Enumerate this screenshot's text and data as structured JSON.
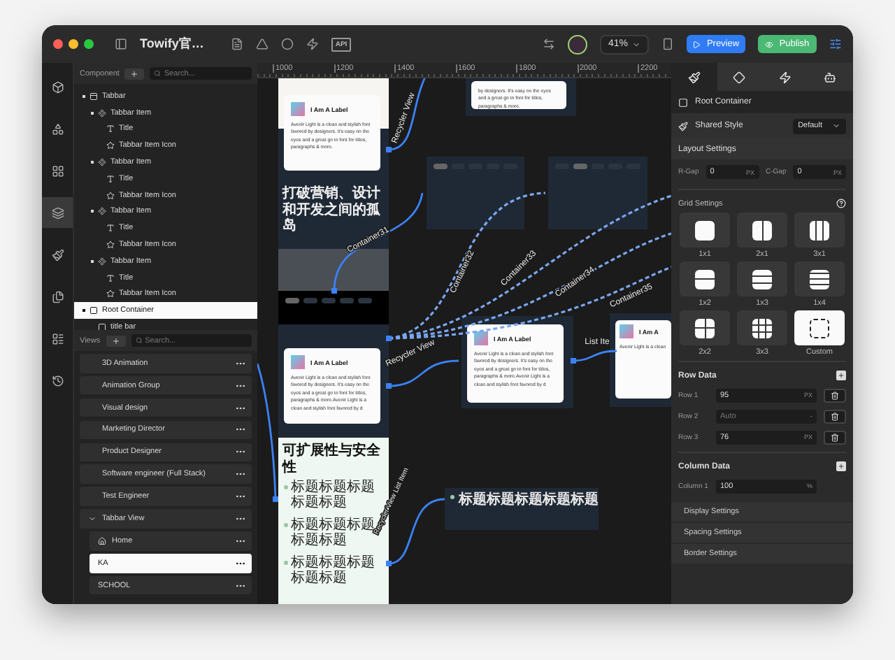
{
  "window": {
    "title": "Towify官…",
    "toolbar_badge": "API",
    "zoom": "41%",
    "buttons": [
      {
        "label": "Preview",
        "kind": "preview"
      },
      {
        "label": "Publish",
        "kind": "publish"
      }
    ]
  },
  "rail": [
    {
      "selected": false
    },
    {
      "selected": false
    },
    {
      "selected": false
    },
    {
      "selected": true
    },
    {
      "selected": false
    },
    {
      "selected": false
    },
    {
      "selected": false
    },
    {
      "selected": false
    }
  ],
  "component_panel": {
    "label": "Component",
    "search_placeholder": "Search...",
    "tree": [
      {
        "label": "Tabbar",
        "kind": "tabbar",
        "selected": false,
        "children": [
          {
            "label": "Tabbar Item",
            "kind": "item",
            "selected": false,
            "children": [
              {
                "label": "Title",
                "kind": "title",
                "selected": false
              },
              {
                "label": "Tabbar Item Icon",
                "kind": "icon",
                "selected": false
              }
            ]
          },
          {
            "label": "Tabbar Item",
            "kind": "item",
            "selected": false,
            "children": [
              {
                "label": "Title",
                "kind": "title",
                "selected": false
              },
              {
                "label": "Tabbar Item Icon",
                "kind": "icon",
                "selected": false
              }
            ]
          },
          {
            "label": "Tabbar Item",
            "kind": "item",
            "selected": false,
            "children": [
              {
                "label": "Title",
                "kind": "title",
                "selected": false
              },
              {
                "label": "Tabbar Item Icon",
                "kind": "icon",
                "selected": false
              }
            ]
          },
          {
            "label": "Tabbar Item",
            "kind": "item",
            "selected": false,
            "children": [
              {
                "label": "Title",
                "kind": "title",
                "selected": false
              },
              {
                "label": "Tabbar Item Icon",
                "kind": "icon",
                "selected": false
              }
            ]
          }
        ]
      },
      {
        "label": "Root Container",
        "kind": "container",
        "selected": true,
        "children": [
          {
            "label": "title bar",
            "kind": "container",
            "selected": false
          }
        ]
      }
    ]
  },
  "views_panel": {
    "label": "Views",
    "search_placeholder": "Search...",
    "items": [
      {
        "label": "3D Animation",
        "kind": "view",
        "selected": false
      },
      {
        "label": "Animation Group",
        "kind": "view",
        "selected": false
      },
      {
        "label": "Visual design",
        "kind": "view",
        "selected": false
      },
      {
        "label": "Marketing Director",
        "kind": "view",
        "selected": false
      },
      {
        "label": "Product Designer",
        "kind": "view",
        "selected": false
      },
      {
        "label": "Software engineer (Full Stack)",
        "kind": "view",
        "selected": false
      },
      {
        "label": "Test Engineer",
        "kind": "view",
        "selected": false
      },
      {
        "label": "Tabbar View",
        "kind": "group",
        "selected": false,
        "expanded": true,
        "children": [
          {
            "label": "Home",
            "kind": "home",
            "selected": false
          },
          {
            "label": "KA",
            "kind": "view",
            "selected": true
          },
          {
            "label": "SCHOOL",
            "kind": "view",
            "selected": false
          }
        ]
      }
    ]
  },
  "canvas": {
    "ruler": [
      "1000",
      "1200",
      "1400",
      "1600",
      "1800",
      "2000",
      "2200"
    ],
    "snippet_card": {
      "body": "by designers. It's easy on the eyes and a great go to font for titles, paragraphs & more."
    },
    "label_cards": [
      {
        "title": "I Am A Label",
        "body": "Avenir Light is a clean and stylish font favored by designers. It's easy on the eyes and a great go to font for titles, paragraphs & more."
      },
      {
        "title": "I Am A Label",
        "body": "Avenir Light is a clean and stylish font favored by designers. It's easy on the eyes and a great go to font for titles, paragraphs & more.Avenir Light is a clean and stylish font favored by d"
      },
      {
        "title": "I Am A Label",
        "body": "Avenir Light is a clean and stylish font favored by designers. It's easy on the eyes and a great go to font for titles, paragraphs & more.Avenir Light is a clean and stylish font favored by d"
      },
      {
        "title": "I Am A",
        "body": "Avenir Light is a clean"
      }
    ],
    "headline": "打破营销、设计和开发之间的孤岛",
    "tab_panels": [
      {
        "tabs": [
          {
            "selected": true
          },
          {
            "selected": false
          },
          {
            "selected": false
          },
          {
            "selected": false
          },
          {
            "selected": false
          }
        ]
      },
      {
        "tabs": [
          {
            "selected": false
          },
          {
            "selected": true
          },
          {
            "selected": false
          },
          {
            "selected": false
          },
          {
            "selected": false
          }
        ]
      },
      {
        "tabs": [
          {
            "selected": true
          },
          {
            "selected": false
          },
          {
            "selected": false
          },
          {
            "selected": false
          },
          {
            "selected": false
          }
        ]
      }
    ],
    "feature_section": {
      "title": "可扩展性与安全性",
      "items": [
        "标题标题标题标题标题",
        "标题标题标题标题标题",
        "标题标题标题标题标题"
      ]
    },
    "list_item_card": {
      "title": "标题标题标题标题标题"
    },
    "connectors": [
      {
        "label": "Recycler View"
      },
      {
        "label": "Container31"
      },
      {
        "label": "Container32"
      },
      {
        "label": "Container33"
      },
      {
        "label": "Container34"
      },
      {
        "label": "Container35"
      },
      {
        "label": "Recycler View"
      },
      {
        "label": "List Ite"
      },
      {
        "label": "Recycler View List Item"
      }
    ]
  },
  "inspector": {
    "tabs": [
      {
        "selected": true
      },
      {
        "selected": false
      },
      {
        "selected": false
      },
      {
        "selected": false
      }
    ],
    "element": "Root Container",
    "shared_style": {
      "label": "Shared Style",
      "value": "Default"
    },
    "layout_settings": {
      "title": "Layout Settings",
      "gaps": [
        {
          "label": "R-Gap",
          "value": "0",
          "unit": "PX"
        },
        {
          "label": "C-Gap",
          "value": "0",
          "unit": "PX"
        }
      ]
    },
    "grid_settings": {
      "title": "Grid Settings",
      "presets": [
        {
          "label": "1x1",
          "kind": "single",
          "selected": false
        },
        {
          "label": "2x1",
          "kind": "cols2",
          "selected": false
        },
        {
          "label": "3x1",
          "kind": "cols3",
          "selected": false
        },
        {
          "label": "1x2",
          "kind": "rows2",
          "selected": false
        },
        {
          "label": "1x3",
          "kind": "rows3",
          "selected": false
        },
        {
          "label": "1x4",
          "kind": "rows4",
          "selected": false
        },
        {
          "label": "2x2",
          "kind": "quad",
          "selected": false
        },
        {
          "label": "3x3",
          "kind": "nine",
          "selected": false
        },
        {
          "label": "Custom",
          "kind": "custom",
          "selected": true
        }
      ]
    },
    "row_data": {
      "title": "Row Data",
      "rows": [
        {
          "label": "Row 1",
          "value": "95",
          "unit": "PX",
          "disabled": false
        },
        {
          "label": "Row 2",
          "value": "Auto",
          "unit": "-",
          "disabled": true
        },
        {
          "label": "Row 3",
          "value": "76",
          "unit": "PX",
          "disabled": false
        }
      ]
    },
    "column_data": {
      "title": "Column Data",
      "columns": [
        {
          "label": "Column 1",
          "value": "100",
          "unit": "%"
        }
      ]
    },
    "collapsed_sections": [
      "Display Settings",
      "Spacing Settings",
      "Border Settings"
    ]
  }
}
